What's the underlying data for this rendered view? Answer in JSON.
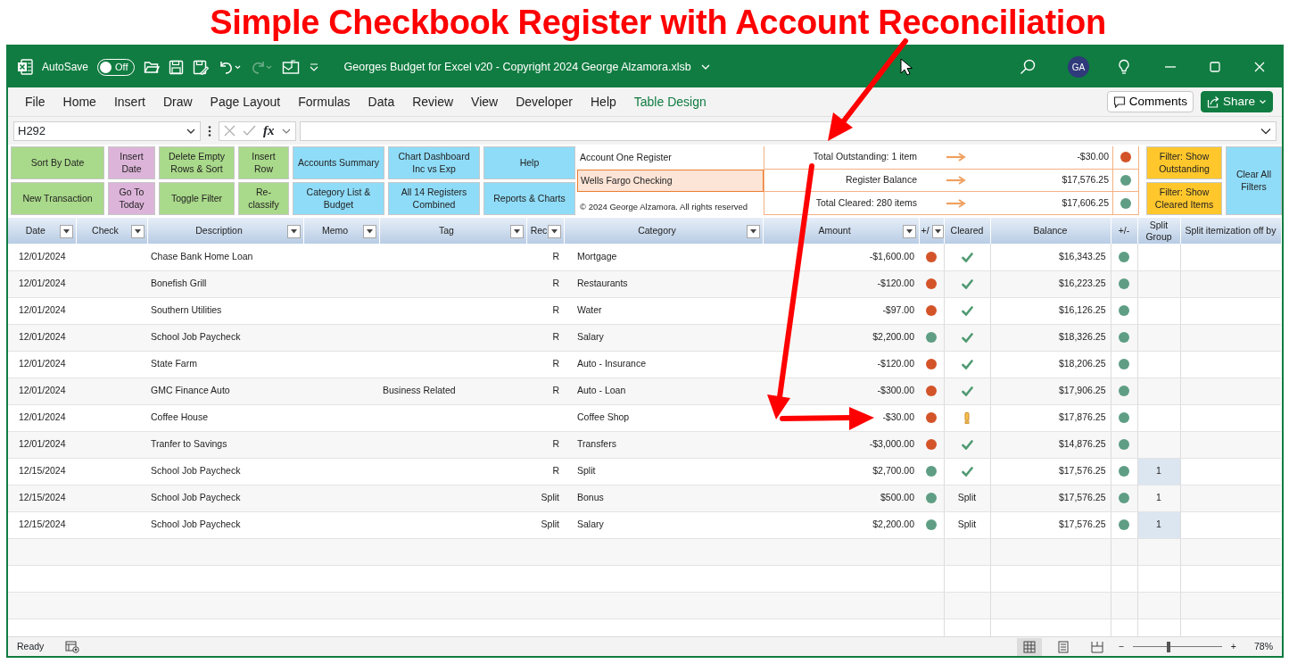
{
  "headline": "Simple Checkbook Register with Account Reconciliation",
  "window": {
    "autosave_label": "AutoSave",
    "autosave": {
      "label": "Off",
      "on": false
    },
    "redo_enabled": false,
    "title": "Georges Budget for Excel v20 - Copyright 2024 George Alzamora.xlsb",
    "avatar": "GA"
  },
  "ribbon_tabs": [
    {
      "label": "File",
      "kind": "tab"
    },
    {
      "label": "Home",
      "kind": "tab"
    },
    {
      "label": "Insert",
      "kind": "tab"
    },
    {
      "label": "Draw",
      "kind": "tab"
    },
    {
      "label": "Page Layout",
      "kind": "tab"
    },
    {
      "label": "Formulas",
      "kind": "tab"
    },
    {
      "label": "Data",
      "kind": "tab"
    },
    {
      "label": "Review",
      "kind": "tab"
    },
    {
      "label": "View",
      "kind": "tab"
    },
    {
      "label": "Developer",
      "kind": "tab"
    },
    {
      "label": "Help",
      "kind": "tab"
    },
    {
      "label": "Table Design",
      "kind": "contextual"
    }
  ],
  "ribbon_buttons": [
    {
      "label": "Comments",
      "kind": "comments"
    },
    {
      "label": "Share",
      "kind": "share"
    }
  ],
  "formula_bar": {
    "name_box": "H292",
    "fx": "fx"
  },
  "macro_buttons": [
    {
      "label": "Sort By Date",
      "color": "#a9d98a"
    },
    {
      "label": "Insert Date",
      "color": "#dcb4d9"
    },
    {
      "label": "Delete Empty Rows & Sort",
      "color": "#a9d98a"
    },
    {
      "label": "Insert Row",
      "color": "#a9d98a"
    },
    {
      "label": "Accounts Summary",
      "color": "#8fdcf8"
    },
    {
      "label": "Chart Dashboard Inc vs Exp",
      "color": "#8fdcf8"
    },
    {
      "label": "Help",
      "color": "#8fdcf8"
    },
    {
      "label": "New Transaction",
      "color": "#a9d98a"
    },
    {
      "label": "Go To Today",
      "color": "#dcb4d9"
    },
    {
      "label": "Toggle Filter",
      "color": "#a9d98a"
    },
    {
      "label": "Re-classify",
      "color": "#a9d98a"
    },
    {
      "label": "Category List & Budget",
      "color": "#8fdcf8"
    },
    {
      "label": "All 14 Registers Combined",
      "color": "#8fdcf8"
    },
    {
      "label": "Reports & Charts",
      "color": "#8fdcf8"
    }
  ],
  "summary": {
    "register_label": "Account One Register",
    "account_name": "Wells Fargo Checking",
    "copyright": "© 2024 George Alzamora. All rights reserved",
    "lines": [
      {
        "label": "Total Outstanding: 1 item",
        "value": "-$30.00",
        "color": "#d4542a"
      },
      {
        "label": "Register Balance",
        "value": "$17,576.25",
        "color": "#5f9e84"
      },
      {
        "label": "Total Cleared: 280 items",
        "value": "$17,606.25",
        "color": "#5f9e84"
      }
    ]
  },
  "filter_buttons": [
    {
      "label": "Filter: Show Outstanding",
      "kind": "filter"
    },
    {
      "label": "Filter: Show Cleared Items",
      "kind": "filter"
    },
    {
      "label": "Clear All Filters",
      "kind": "clear"
    }
  ],
  "table": {
    "columns": [
      {
        "label": "Date",
        "filter": true
      },
      {
        "label": "Check",
        "filter": true
      },
      {
        "label": "Description",
        "filter": true
      },
      {
        "label": "Memo",
        "filter": true
      },
      {
        "label": "Tag",
        "filter": true
      },
      {
        "label": "Rec",
        "filter": true
      },
      {
        "label": "Category",
        "filter": true
      },
      {
        "label": "Amount",
        "filter": true
      },
      {
        "label": "+/",
        "filter": true
      },
      {
        "label": "Cleared",
        "filter": false
      },
      {
        "label": "Balance",
        "filter": false
      },
      {
        "label": "+/-",
        "filter": false
      },
      {
        "label": "Split Group",
        "filter": false
      },
      {
        "label": "Split itemization off by",
        "filter": false
      }
    ],
    "rows": [
      {
        "date": "12/01/2024",
        "description": "Chase Bank Home Loan",
        "rec": "R",
        "category": "Mortgage",
        "amount": "-$1,600.00",
        "amount_dot": {
          "color": "#d4542a"
        },
        "cleared": {
          "kind": "check"
        },
        "balance": "$16,343.25",
        "balance_dot": {
          "color": "#5f9e84"
        }
      },
      {
        "date": "12/01/2024",
        "description": "Bonefish Grill",
        "rec": "R",
        "category": "Restaurants",
        "amount": "-$120.00",
        "amount_dot": {
          "color": "#d4542a"
        },
        "cleared": {
          "kind": "check"
        },
        "balance": "$16,223.25",
        "balance_dot": {
          "color": "#5f9e84"
        }
      },
      {
        "date": "12/01/2024",
        "description": "Southern Utilities",
        "rec": "R",
        "category": "Water",
        "amount": "-$97.00",
        "amount_dot": {
          "color": "#d4542a"
        },
        "cleared": {
          "kind": "check"
        },
        "balance": "$16,126.25",
        "balance_dot": {
          "color": "#5f9e84"
        }
      },
      {
        "date": "12/01/2024",
        "description": "School Job Paycheck",
        "rec": "R",
        "category": "Salary",
        "amount": "$2,200.00",
        "amount_dot": {
          "color": "#5f9e84"
        },
        "cleared": {
          "kind": "check"
        },
        "balance": "$18,326.25",
        "balance_dot": {
          "color": "#5f9e84"
        }
      },
      {
        "date": "12/01/2024",
        "description": "State Farm",
        "rec": "R",
        "category": "Auto - Insurance",
        "amount": "-$120.00",
        "amount_dot": {
          "color": "#d4542a"
        },
        "cleared": {
          "kind": "check"
        },
        "balance": "$18,206.25",
        "balance_dot": {
          "color": "#5f9e84"
        }
      },
      {
        "date": "12/01/2024",
        "description": "GMC Finance Auto",
        "tag": "Business Related",
        "rec": "R",
        "category": "Auto - Loan",
        "amount": "-$300.00",
        "amount_dot": {
          "color": "#d4542a"
        },
        "cleared": {
          "kind": "check"
        },
        "balance": "$17,906.25",
        "balance_dot": {
          "color": "#5f9e84"
        }
      },
      {
        "date": "12/01/2024",
        "description": "Coffee House",
        "category": "Coffee Shop",
        "amount": "-$30.00",
        "amount_dot": {
          "color": "#d4542a"
        },
        "cleared": {
          "kind": "pending"
        },
        "balance": "$17,876.25",
        "balance_dot": {
          "color": "#5f9e84"
        }
      },
      {
        "date": "12/01/2024",
        "description": "Tranfer to Savings",
        "rec": "R",
        "category": "Transfers",
        "amount": "-$3,000.00",
        "amount_dot": {
          "color": "#d4542a"
        },
        "cleared": {
          "kind": "check"
        },
        "balance": "$14,876.25",
        "balance_dot": {
          "color": "#5f9e84"
        }
      },
      {
        "date": "12/15/2024",
        "description": "School Job Paycheck",
        "rec": "R",
        "category": "Split",
        "amount": "$2,700.00",
        "amount_dot": {
          "color": "#5f9e84"
        },
        "cleared": {
          "kind": "check"
        },
        "balance": "$17,576.25",
        "balance_dot": {
          "color": "#5f9e84"
        },
        "split_group": "1"
      },
      {
        "date": "12/15/2024",
        "description": "School Job Paycheck",
        "rec": "Split",
        "category": "Bonus",
        "amount": "$500.00",
        "amount_dot": {
          "color": "#5f9e84"
        },
        "cleared": {
          "kind": "text",
          "text": "Split"
        },
        "balance": "$17,576.25",
        "balance_dot": {
          "color": "#5f9e84"
        },
        "split_group": "1"
      },
      {
        "date": "12/15/2024",
        "description": "School Job Paycheck",
        "rec": "Split",
        "category": "Salary",
        "amount": "$2,200.00",
        "amount_dot": {
          "color": "#5f9e84"
        },
        "cleared": {
          "kind": "text",
          "text": "Split"
        },
        "balance": "$17,576.25",
        "balance_dot": {
          "color": "#5f9e84"
        },
        "split_group": "1"
      }
    ]
  },
  "status_bar": {
    "status": "Ready",
    "views": [
      {
        "kind": "normal",
        "selected": true
      },
      {
        "kind": "page-layout",
        "selected": false
      },
      {
        "kind": "page-break",
        "selected": false
      }
    ],
    "zoom_minus": "−",
    "zoom_plus": "+",
    "zoom": {
      "level": 0.4
    },
    "zoom_label": "78%"
  }
}
